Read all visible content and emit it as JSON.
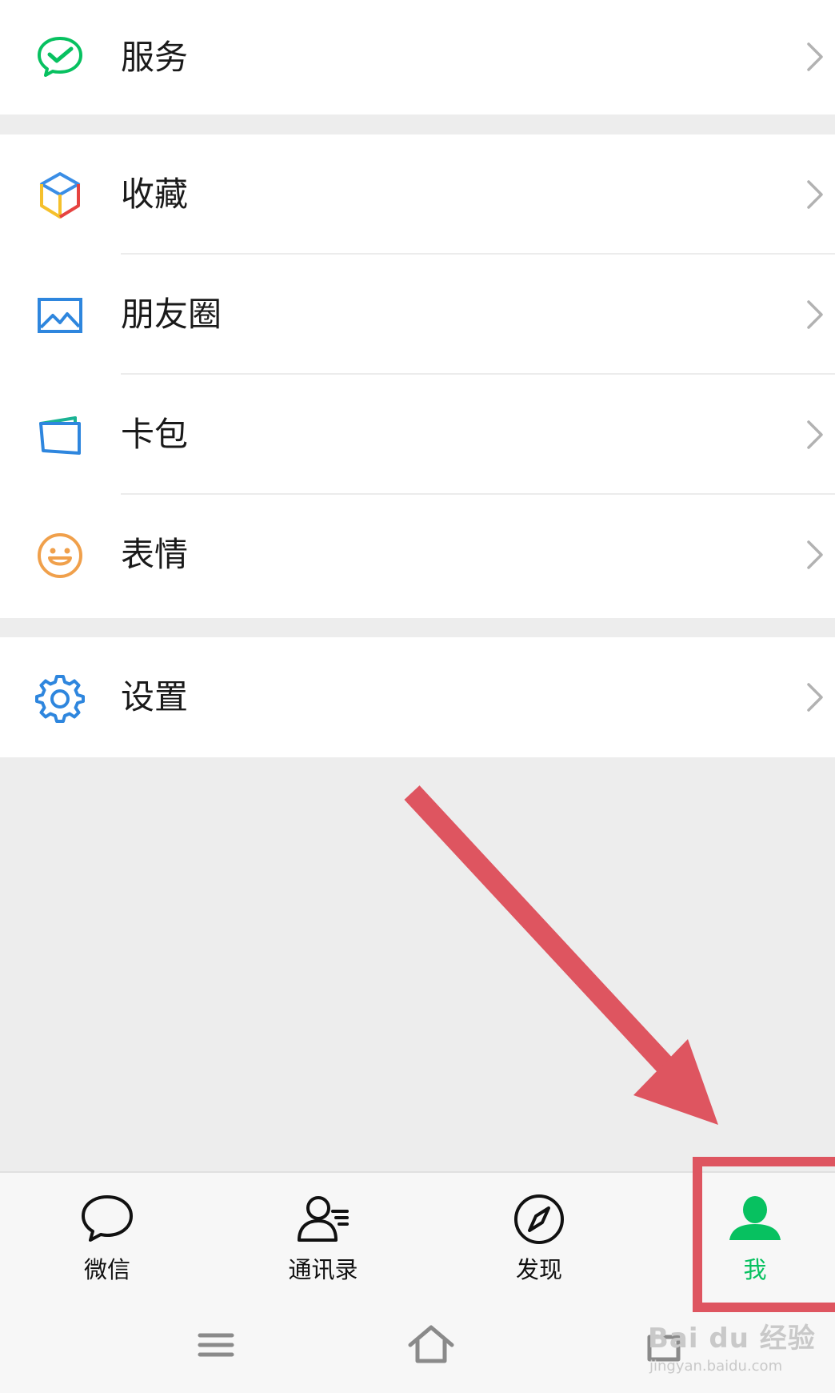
{
  "groups": [
    {
      "items": [
        {
          "label": "服务",
          "icon": "wechat-pay-icon"
        }
      ]
    },
    {
      "items": [
        {
          "label": "收藏",
          "icon": "favorites-cube-icon"
        },
        {
          "label": "朋友圈",
          "icon": "moments-picture-icon"
        },
        {
          "label": "卡包",
          "icon": "card-wallet-icon"
        },
        {
          "label": "表情",
          "icon": "sticker-smile-icon"
        }
      ]
    },
    {
      "items": [
        {
          "label": "设置",
          "icon": "gear-icon"
        }
      ]
    }
  ],
  "tabbar": {
    "tabs": [
      {
        "label": "微信",
        "icon": "chat-bubble-icon",
        "active": false
      },
      {
        "label": "通讯录",
        "icon": "contacts-icon",
        "active": false
      },
      {
        "label": "发现",
        "icon": "compass-icon",
        "active": false
      },
      {
        "label": "我",
        "icon": "person-icon",
        "active": true
      }
    ]
  },
  "colors": {
    "accent": "#07c160",
    "annotation": "#de5560",
    "background": "#ededed"
  },
  "watermark": {
    "main": "Bai du 经验",
    "sub": "jingyan.baidu.com"
  }
}
